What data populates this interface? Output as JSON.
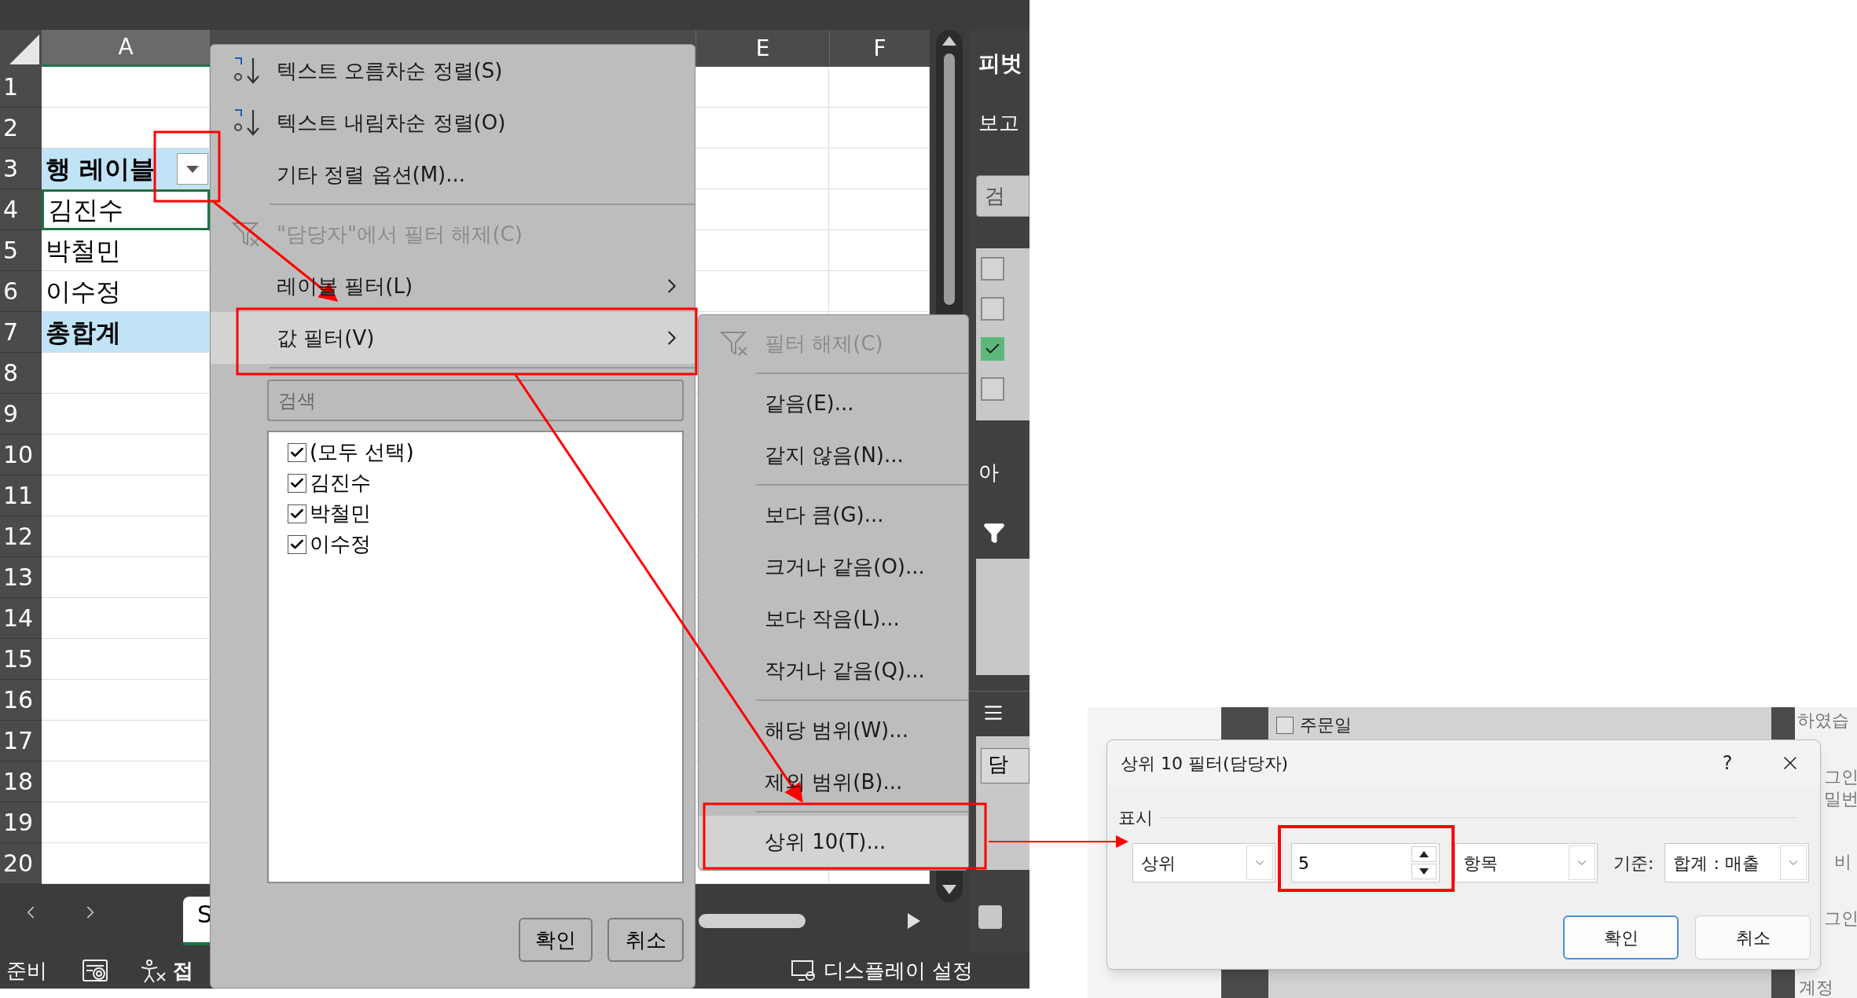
{
  "sheet": {
    "columns_left": [
      "A"
    ],
    "columns_right": [
      "E",
      "F"
    ],
    "rows": [
      {
        "number": "1",
        "kind": "blank",
        "selected": false
      },
      {
        "number": "2",
        "kind": "blank",
        "selected": false
      },
      {
        "number": "3",
        "kind": "header",
        "cell": "행 레이블",
        "selected": false
      },
      {
        "number": "4",
        "kind": "item",
        "cell": "김진수",
        "selected": true
      },
      {
        "number": "5",
        "kind": "item",
        "cell": "박철민",
        "selected": false
      },
      {
        "number": "6",
        "kind": "item",
        "cell": "이수정",
        "selected": false
      },
      {
        "number": "7",
        "kind": "total",
        "cell": "총합계",
        "selected": false
      },
      {
        "number": "8",
        "kind": "blank",
        "selected": false
      },
      {
        "number": "9",
        "kind": "blank",
        "selected": false
      },
      {
        "number": "10",
        "kind": "blank",
        "selected": false
      },
      {
        "number": "11",
        "kind": "blank",
        "selected": false
      },
      {
        "number": "12",
        "kind": "blank",
        "selected": false
      },
      {
        "number": "13",
        "kind": "blank",
        "selected": false
      },
      {
        "number": "14",
        "kind": "blank",
        "selected": false
      },
      {
        "number": "15",
        "kind": "blank",
        "selected": false
      },
      {
        "number": "16",
        "kind": "blank",
        "selected": false
      },
      {
        "number": "17",
        "kind": "blank",
        "selected": false
      },
      {
        "number": "18",
        "kind": "blank",
        "selected": false
      },
      {
        "number": "19",
        "kind": "blank",
        "selected": false
      },
      {
        "number": "20",
        "kind": "blank",
        "selected": false
      }
    ],
    "sheet_tab": "S"
  },
  "filter_menu": {
    "items": [
      {
        "kind": "sort-ascending",
        "label": "텍스트 오름차순 정렬(S)",
        "disabled": false,
        "selected": false,
        "submenu": false
      },
      {
        "kind": "sort-descending",
        "label": "텍스트 내림차순 정렬(O)",
        "disabled": false,
        "selected": false,
        "submenu": false
      },
      {
        "kind": "plain",
        "label": "기타 정렬 옵션(M)...",
        "disabled": false,
        "selected": false,
        "submenu": false
      },
      {
        "kind": "separator"
      },
      {
        "kind": "clear-filter",
        "label": "\"담당자\"에서 필터 해제(C)",
        "disabled": true,
        "selected": false,
        "submenu": false
      },
      {
        "kind": "plain",
        "label": "레이블 필터(L)",
        "disabled": false,
        "selected": false,
        "submenu": true
      },
      {
        "kind": "plain",
        "label": "값 필터(V)",
        "disabled": false,
        "selected": true,
        "submenu": true
      },
      {
        "kind": "separator"
      }
    ],
    "search": {
      "placeholder": "검색"
    },
    "values": [
      {
        "label": "(모두 선택)",
        "checked": true
      },
      {
        "label": "김진수",
        "checked": true
      },
      {
        "label": "박철민",
        "checked": true
      },
      {
        "label": "이수정",
        "checked": true
      }
    ],
    "buttons": [
      "확인",
      "취소"
    ]
  },
  "value_filter_submenu": {
    "items": [
      {
        "kind": "clear-filter",
        "label": "필터 해제(C)",
        "disabled": true,
        "selected": false
      },
      {
        "kind": "separator"
      },
      {
        "kind": "plain",
        "label": "같음(E)...",
        "disabled": false,
        "selected": false
      },
      {
        "kind": "plain",
        "label": "같지 않음(N)...",
        "disabled": false,
        "selected": false
      },
      {
        "kind": "separator"
      },
      {
        "kind": "plain",
        "label": "보다 큼(G)...",
        "disabled": false,
        "selected": false
      },
      {
        "kind": "plain",
        "label": "크거나 같음(O)...",
        "disabled": false,
        "selected": false
      },
      {
        "kind": "plain",
        "label": "보다 작음(L)...",
        "disabled": false,
        "selected": false
      },
      {
        "kind": "plain",
        "label": "작거나 같음(Q)...",
        "disabled": false,
        "selected": false
      },
      {
        "kind": "separator"
      },
      {
        "kind": "plain",
        "label": "해당 범위(W)...",
        "disabled": false,
        "selected": false
      },
      {
        "kind": "plain",
        "label": "제외 범위(B)...",
        "disabled": false,
        "selected": false
      },
      {
        "kind": "separator"
      },
      {
        "kind": "plain",
        "label": "상위 10(T)...",
        "disabled": false,
        "selected": true
      }
    ]
  },
  "field_pane": {
    "title": "피벗",
    "subtitle": "보고",
    "search": {
      "placeholder": "검"
    },
    "fields": [
      {
        "checked": false
      },
      {
        "checked": false
      },
      {
        "checked": true
      },
      {
        "checked": false
      }
    ],
    "area_label": "아",
    "row_field": "담",
    "footer_checkbox": {
      "checked": false
    }
  },
  "status_bar": {
    "status": "준비",
    "accessibility": "접",
    "display_settings": "디스플레이 설정"
  },
  "dialog_backdrop": {
    "field": "주문일",
    "field_checked": false,
    "side_texts": [
      "하였습",
      "그인",
      "밀번",
      "비",
      "그인",
      "계정"
    ]
  },
  "dialog": {
    "title": "상위 10 필터(담당자)",
    "help": "?",
    "group": "표시",
    "direction": "상위",
    "count": "5",
    "unit": "항목",
    "basis_label": "기준:",
    "basis": "합계 : 매출",
    "buttons": [
      {
        "label": "확인",
        "default": true
      },
      {
        "label": "취소",
        "default": false
      }
    ]
  }
}
